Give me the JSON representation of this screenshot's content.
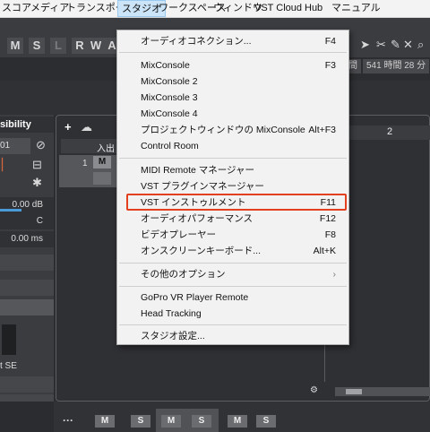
{
  "menubar": {
    "items": [
      {
        "label": "スコア"
      },
      {
        "label": "メディア"
      },
      {
        "label": "トランスポート"
      },
      {
        "label": "スタジオ"
      },
      {
        "label": "ワークスペース"
      },
      {
        "label": "ウィンドウ"
      },
      {
        "label": "VST Cloud"
      },
      {
        "label": "Hub"
      },
      {
        "label": "マニュアル"
      }
    ]
  },
  "toolbar": {
    "mode_buttons": [
      "M",
      "S",
      "L",
      "R",
      "W",
      "A"
    ],
    "time_badge": "541 時間 28 分",
    "clock_badge": "間"
  },
  "inspector": {
    "title": "sibility",
    "track_num": "01",
    "volume": "0.00 dB",
    "pan": "C",
    "delay": "0.00 ms",
    "plugin": "t SE"
  },
  "project": {
    "ruler_mark": "2",
    "track_label": "入出",
    "track_number": "1",
    "track_mute": "M"
  },
  "lower": {
    "buttons": [
      "M",
      "M",
      "S",
      "S",
      "M",
      "S"
    ]
  },
  "menu": {
    "items": [
      {
        "label": "オーディオコネクション...",
        "shortcut": "F4"
      },
      {
        "label": "MixConsole",
        "shortcut": "F3"
      },
      {
        "label": "MixConsole 2",
        "shortcut": ""
      },
      {
        "label": "MixConsole 3",
        "shortcut": ""
      },
      {
        "label": "MixConsole 4",
        "shortcut": ""
      },
      {
        "label": "プロジェクトウィンドウの MixConsole",
        "shortcut": "Alt+F3"
      },
      {
        "label": "Control Room",
        "shortcut": ""
      },
      {
        "label": "MIDI Remote マネージャー",
        "shortcut": ""
      },
      {
        "label": "VST プラグインマネージャー",
        "shortcut": ""
      },
      {
        "label": "VST インストゥルメント",
        "shortcut": "F11"
      },
      {
        "label": "オーディオパフォーマンス",
        "shortcut": "F12"
      },
      {
        "label": "ビデオプレーヤー",
        "shortcut": "F8"
      },
      {
        "label": "オンスクリーンキーボード...",
        "shortcut": "Alt+K"
      },
      {
        "label": "その他のオプション",
        "shortcut": "›"
      },
      {
        "label": "GoPro VR Player Remote",
        "shortcut": ""
      },
      {
        "label": "Head Tracking",
        "shortcut": ""
      },
      {
        "label": "スタジオ設定...",
        "shortcut": ""
      }
    ]
  },
  "colors": {
    "highlight": "#e2401f",
    "menu_bg": "#f2f2f2",
    "active_menu": "#cce4f7"
  }
}
